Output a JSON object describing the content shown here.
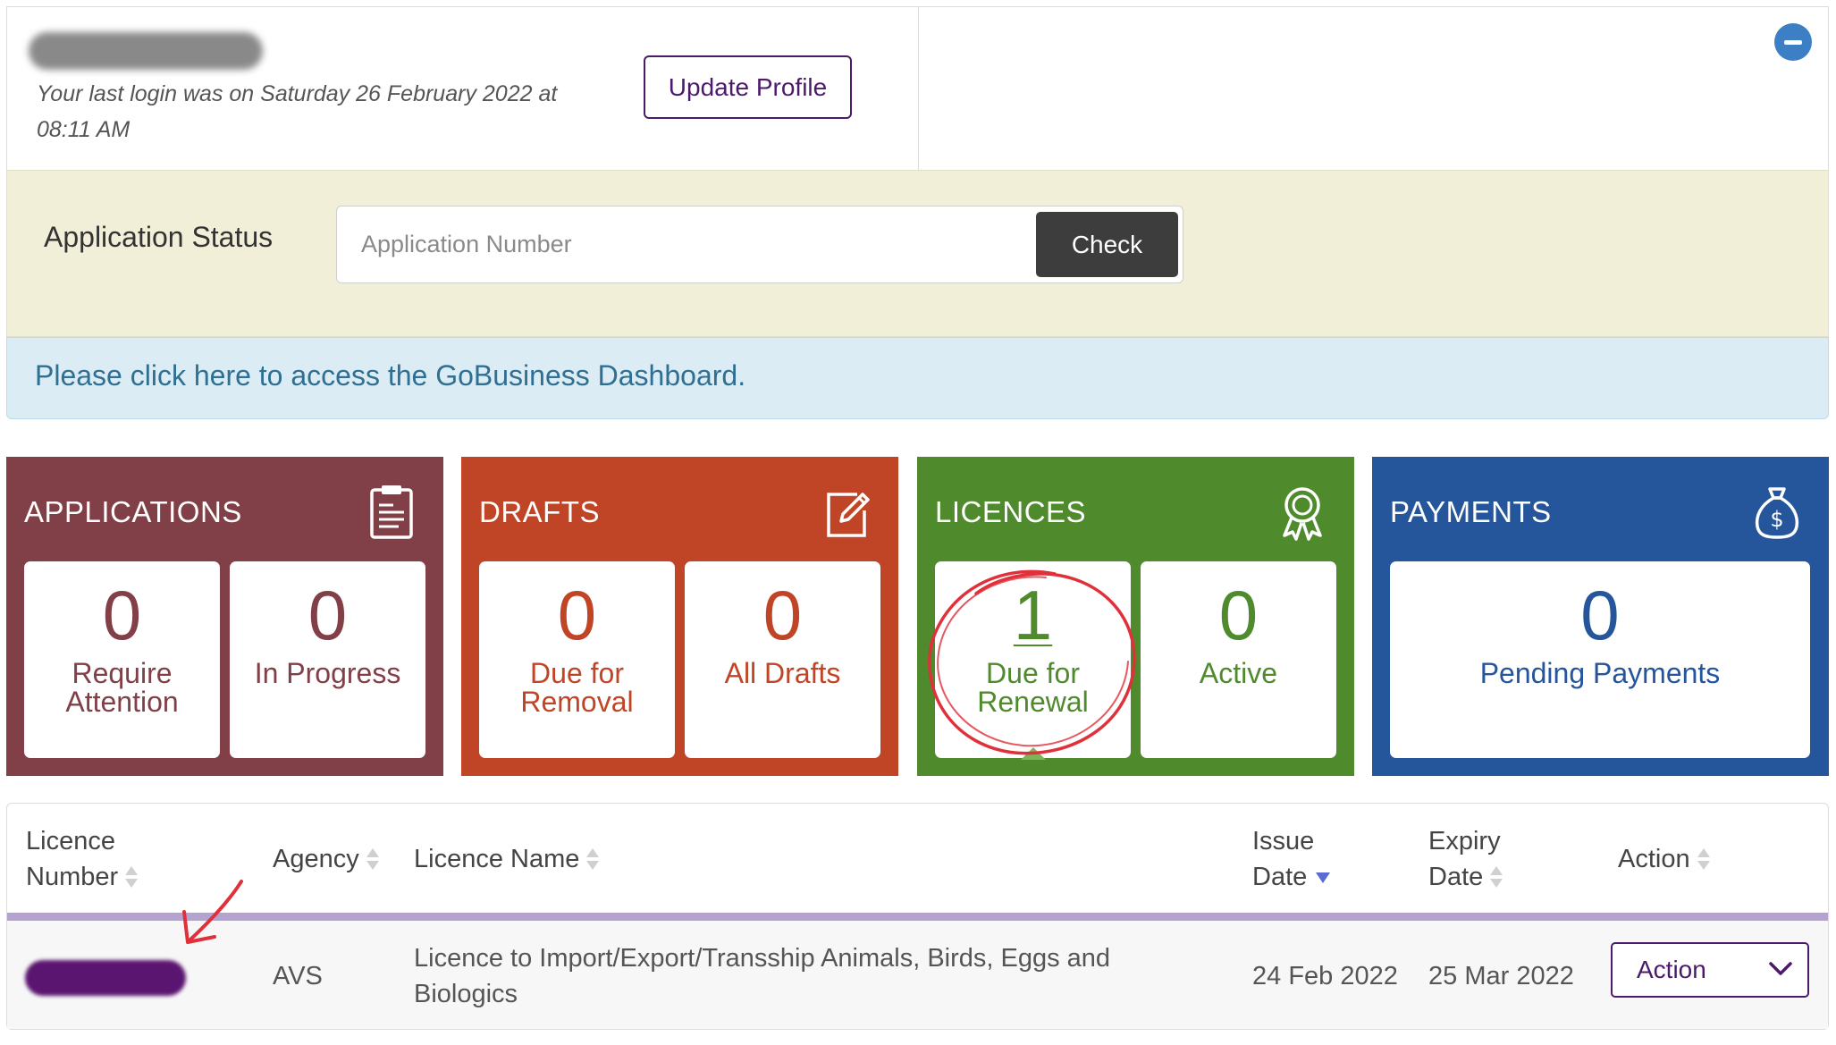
{
  "profile": {
    "last_login": "Your last login was on Saturday 26 February 2022 at 08:11 AM",
    "update_button": "Update Profile"
  },
  "application_status": {
    "label": "Application Status",
    "input_placeholder": "Application Number",
    "check_button": "Check"
  },
  "banner": {
    "text": "Please click here to access the GoBusiness Dashboard."
  },
  "tiles": {
    "applications": {
      "title": "APPLICATIONS",
      "icon": "clipboard-icon",
      "color": "#813f47",
      "cards": [
        {
          "count": "0",
          "label": "Require Attention"
        },
        {
          "count": "0",
          "label": "In Progress"
        }
      ]
    },
    "drafts": {
      "title": "DRAFTS",
      "icon": "edit-icon",
      "color": "#c04526",
      "cards": [
        {
          "count": "0",
          "label": "Due for Removal"
        },
        {
          "count": "0",
          "label": "All Drafts"
        }
      ]
    },
    "licences": {
      "title": "LICENCES",
      "icon": "award-ribbon-icon",
      "color": "#4f8a2d",
      "cards": [
        {
          "count": "1",
          "label": "Due for Renewal"
        },
        {
          "count": "0",
          "label": "Active"
        }
      ]
    },
    "payments": {
      "title": "PAYMENTS",
      "icon": "money-bag-icon",
      "color": "#25559b",
      "cards": [
        {
          "count": "0",
          "label": "Pending Payments"
        }
      ]
    }
  },
  "table": {
    "headers": {
      "licence_number": "Licence Number",
      "agency": "Agency",
      "licence_name": "Licence Name",
      "issue_date": "Issue Date",
      "expiry_date": "Expiry Date",
      "action": "Action"
    },
    "rows": [
      {
        "agency": "AVS",
        "licence_name": "Licence to Import/Export/Transship Animals, Birds, Eggs and Biologics",
        "issue_date": "24 Feb 2022",
        "expiry_date": "25 Mar 2022",
        "action": "Action"
      }
    ]
  }
}
